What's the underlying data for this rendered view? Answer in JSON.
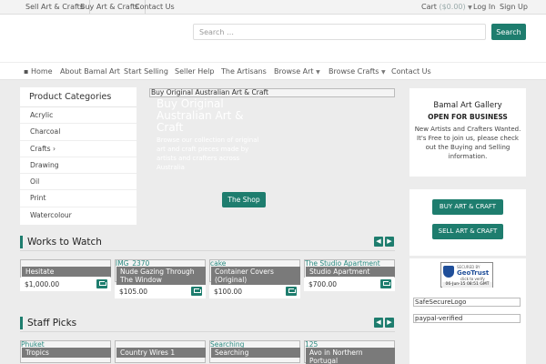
{
  "topbar": {
    "left_links": [
      "Sell Art & Crafts",
      "Buy Art & Crafts",
      "Contact Us"
    ],
    "cart_label": "Cart",
    "cart_amount": "($0.00)",
    "login": "Log In",
    "signup": "Sign Up"
  },
  "header": {
    "search_placeholder": "Search …",
    "search_button": "Search"
  },
  "nav": {
    "items": [
      "Home",
      "About Bamal Art",
      "Start Selling",
      "Seller Help",
      "The Artisans",
      "Browse Art",
      "Browse Crafts",
      "Contact Us"
    ]
  },
  "categories": {
    "title": "Product Categories",
    "items": [
      "Acrylic",
      "Charcoal",
      "Crafts ›",
      "Drawing",
      "Oil",
      "Print",
      "Watercolour"
    ]
  },
  "slider": {
    "image_alt": "Buy Original Australian Art & Craft",
    "heading": "Buy Original Australian Art & Craft",
    "text": "Browse our collection of original art and craft pieces made by artists and crafters across Australia",
    "button": "The Shop"
  },
  "gallery": {
    "title": "Bamal Art Gallery",
    "status": "OPEN FOR BUSINESS",
    "text": "New Artists and Crafters Wanted. It's Free to join us, please check out the Buying and Selling information."
  },
  "actions": {
    "buy": "BUY ART & CRAFT",
    "sell": "SELL ART & CRAFT"
  },
  "trust": {
    "badge_top": "SECURED BY",
    "badge_name": "GeoTrust",
    "badge_click": "click to verify",
    "badge_date": "06-Jun-15 08:51 GMT",
    "alt1": "SafeSecureLogo",
    "alt2": "paypal-verified"
  },
  "works_to_watch": {
    "title": "Works to Watch",
    "items": [
      {
        "alt": "",
        "name": "Hesitate",
        "price": "$1,000.00"
      },
      {
        "alt": "IMG_2370",
        "name": "Nude Gazing Through The Window",
        "price": "$105.00"
      },
      {
        "alt": "cake",
        "name": "Container Covers (Original)",
        "price": "$100.00"
      },
      {
        "alt": "The Studio Apartment",
        "name": "Studio Apartment",
        "price": "$700.00"
      }
    ]
  },
  "staff_picks": {
    "title": "Staff Picks",
    "items": [
      {
        "alt": "Phuket",
        "name": "Tropics"
      },
      {
        "alt": "",
        "name": "Country Wires 1"
      },
      {
        "alt": "Searching",
        "name": "Searching"
      },
      {
        "alt": "125",
        "name": "Avo in Northern Portugal"
      }
    ]
  },
  "colors": {
    "accent": "#1e7d6e",
    "card_label_bg": "#7a7a7a",
    "page_bg": "#ececec"
  }
}
